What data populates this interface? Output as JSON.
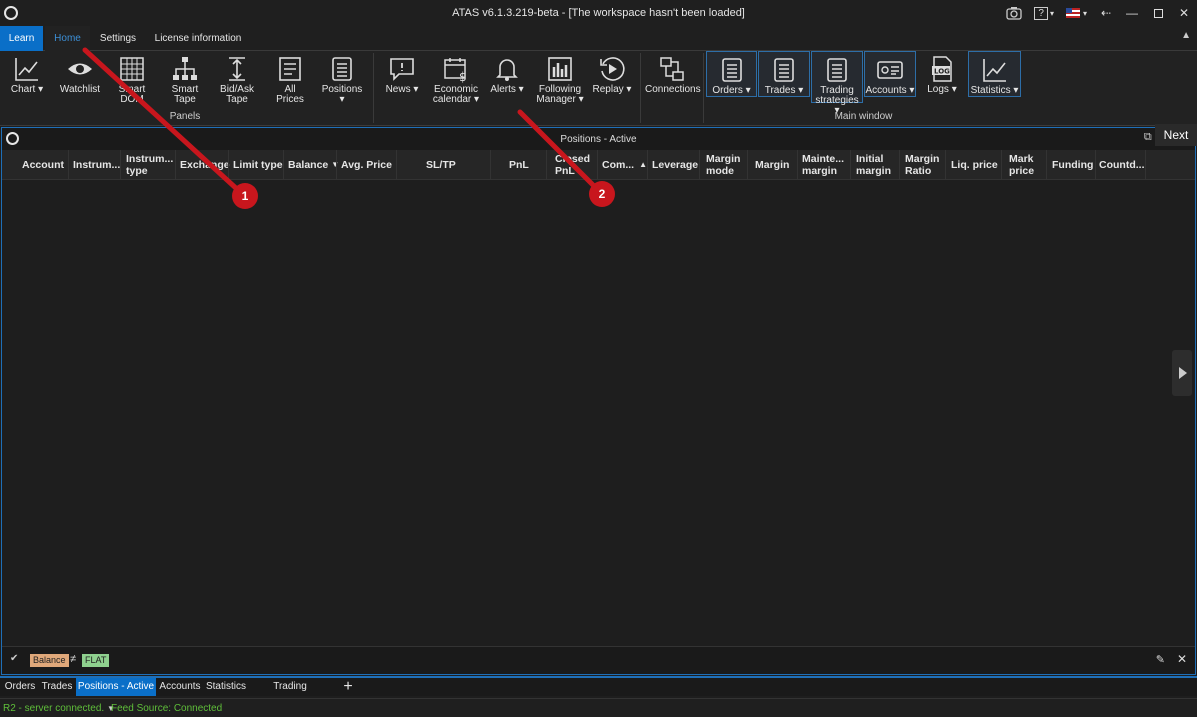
{
  "window": {
    "title": "ATAS v6.1.3.219-beta - [The workspace hasn't been loaded]",
    "help_label": "?"
  },
  "ribbon_tabs": [
    "Learn",
    "Home",
    "Settings",
    "License information"
  ],
  "ribbon": {
    "panels_group": "Panels",
    "main_window_group": "Main window",
    "buttons": {
      "chart": "Chart",
      "watchlist": "Watchlist",
      "smart_dom_1": "Smart",
      "smart_dom_2": "DOM",
      "smart_tape_1": "Smart",
      "smart_tape_2": "Tape",
      "bidask_1": "Bid/Ask",
      "bidask_2": "Tape",
      "allprices_1": "All",
      "allprices_2": "Prices",
      "positions": "Positions",
      "news": "News",
      "econ_1": "Economic",
      "econ_2": "calendar",
      "alerts": "Alerts",
      "following_1": "Following",
      "following_2": "Manager",
      "replay": "Replay",
      "connections": "Connections",
      "orders": "Orders",
      "trades": "Trades",
      "strategies_1": "Trading",
      "strategies_2": "strategies",
      "accounts": "Accounts",
      "logs": "Logs",
      "statistics": "Statistics"
    }
  },
  "panel": {
    "title": "Positions - Active",
    "columns": [
      [
        "Account",
        ""
      ],
      [
        "Instrum...",
        ""
      ],
      [
        "Instrum...",
        "type"
      ],
      [
        "Exchange",
        ""
      ],
      [
        "Limit type",
        ""
      ],
      [
        "Balance",
        ""
      ],
      [
        "Avg. Price",
        ""
      ],
      [
        "SL/TP",
        ""
      ],
      [
        "PnL",
        ""
      ],
      [
        "Closed",
        "PnL"
      ],
      [
        "Com...",
        ""
      ],
      [
        "Leverage",
        ""
      ],
      [
        "Margin",
        "mode"
      ],
      [
        "Margin",
        ""
      ],
      [
        "Mainte...",
        "margin"
      ],
      [
        "Initial",
        "margin"
      ],
      [
        "Margin",
        "Ratio"
      ],
      [
        "Liq. price",
        ""
      ],
      [
        "Mark",
        "price"
      ],
      [
        "Funding",
        ""
      ],
      [
        "Countd...",
        ""
      ]
    ],
    "filter": {
      "field": "Balance",
      "operator": "≠",
      "value": "FLAT"
    }
  },
  "tooltip": {
    "next": "Next"
  },
  "bottom_tabs": [
    "Orders",
    "Trades",
    "Positions - Active",
    "Accounts",
    "Statistics",
    "Trading strategies"
  ],
  "status": {
    "server": "R2 - server connected.",
    "feed": "Feed Source: Connected"
  },
  "annotations": {
    "m1": "1",
    "m2": "2"
  },
  "colors": {
    "accent": "#0a6fc8",
    "marker": "#c8161d",
    "status_green": "#5fbf3a"
  }
}
